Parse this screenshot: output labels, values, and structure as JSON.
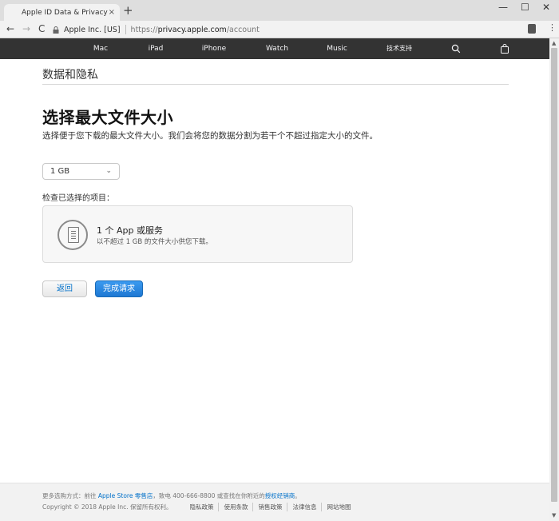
{
  "browser": {
    "tab_title": "Apple ID Data & Privacy",
    "tab_close": "×",
    "new_tab": "+",
    "win_min": "—",
    "win_max": "☐",
    "win_close": "✕",
    "back": "←",
    "forward": "→",
    "reload": "C",
    "url_org": "Apple Inc. [US]",
    "url_scheme": "https://",
    "url_host": "privacy.apple.com",
    "url_path": "/account",
    "menu": "⋮"
  },
  "global_nav": {
    "apple_logo": "",
    "items": [
      "Mac",
      "iPad",
      "iPhone",
      "Watch",
      "Music",
      "技术支持"
    ],
    "search_icon": "⌕",
    "bag_icon": "bag-icon"
  },
  "page": {
    "subnav_title": "数据和隐私",
    "heading": "选择最大文件大小",
    "description": "选择便于您下载的最大文件大小。我们会将您的数据分割为若干个不超过指定大小的文件。",
    "size_select": {
      "value": "1 GB",
      "chevron": "⌄"
    },
    "check_label": "检查已选择的项目：",
    "card": {
      "icon": "document-icon",
      "title": "1 个 App 或服务",
      "subtitle": "以不超过 1 GB 的文件大小供您下载。"
    },
    "back_button": "返回",
    "done_button": "完成请求"
  },
  "footer": {
    "line1_prefix": "更多选购方式：前往 ",
    "store_link": "Apple Store 零售店",
    "line1_mid": "，致电 400-666-8800 或查找在你附近的",
    "reseller_link": "授权经销商",
    "line1_end": "。",
    "copyright": "Copyright © 2018 Apple Inc. 保留所有权利。",
    "links": [
      "隐私政策",
      "使用条款",
      "销售政策",
      "法律信息",
      "网站地图"
    ]
  }
}
